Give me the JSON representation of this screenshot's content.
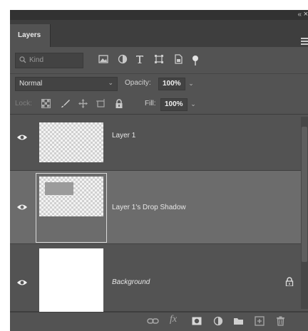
{
  "panel": {
    "collapse_glyph": "«",
    "close_glyph": "×",
    "tab_label": "Layers"
  },
  "filter": {
    "kind_label": "Kind",
    "icons": [
      "image-filter-icon",
      "adjustment-filter-icon",
      "type-filter-icon",
      "shape-filter-icon",
      "smart-object-filter-icon",
      "filter-toggle"
    ]
  },
  "blend": {
    "mode": "Normal",
    "opacity_label": "Opacity:",
    "opacity_value": "100%"
  },
  "lock": {
    "lock_label": "Lock:",
    "fill_label": "Fill:",
    "fill_value": "100%",
    "icons": [
      "lock-transparent-pixels-icon",
      "lock-image-pixels-icon",
      "lock-position-icon",
      "lock-artboard-icon",
      "lock-all-icon"
    ]
  },
  "layers": [
    {
      "name": "Layer 1",
      "selected": false,
      "italic": false,
      "locked": false
    },
    {
      "name": "Layer 1's Drop Shadow",
      "selected": true,
      "italic": false,
      "locked": false
    },
    {
      "name": "Background",
      "selected": false,
      "italic": true,
      "locked": true
    }
  ],
  "footer": {
    "buttons": [
      "link-layers-icon",
      "layer-style-icon",
      "add-mask-icon",
      "new-fill-adjustment-icon",
      "new-group-icon",
      "new-layer-icon",
      "delete-layer-icon"
    ],
    "fx_label": "fx"
  },
  "colors": {
    "panel_bg": "#535353",
    "selected_row": "#6c6c6c",
    "tab_bar": "#3e3e3e"
  }
}
